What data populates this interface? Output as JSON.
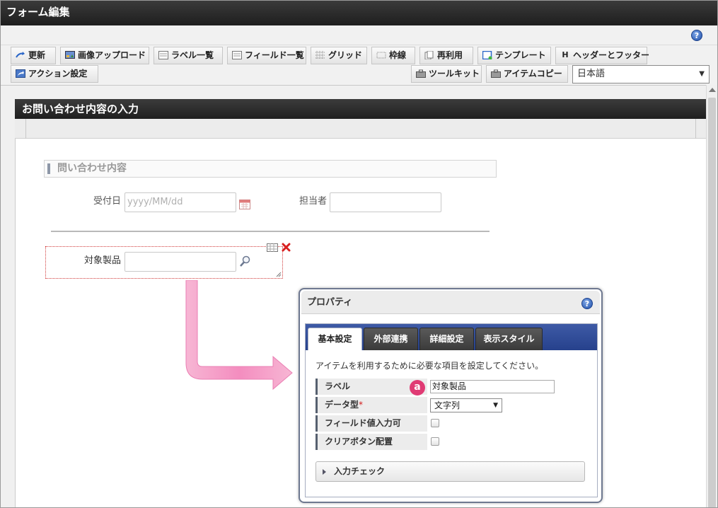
{
  "window": {
    "title": "フォーム編集"
  },
  "toolbar": {
    "row1": [
      {
        "label": "更新",
        "icon": "update-icon"
      },
      {
        "label": "画像アップロード",
        "icon": "image-upload-icon"
      },
      {
        "label": "ラベル一覧",
        "icon": "label-list-icon"
      },
      {
        "label": "フィールド一覧",
        "icon": "field-list-icon"
      },
      {
        "label": "グリッド",
        "icon": "grid-icon"
      },
      {
        "label": "枠線",
        "icon": "border-icon"
      },
      {
        "label": "再利用",
        "icon": "reuse-icon"
      },
      {
        "label": "テンプレート",
        "icon": "template-icon"
      },
      {
        "label": "ヘッダーとフッター",
        "icon": "header-footer-icon",
        "glyph": "H"
      }
    ],
    "row2": [
      {
        "label": "アクション設定",
        "icon": "action-settings-icon"
      },
      {
        "label": "ツールキット",
        "icon": "toolkit-icon"
      },
      {
        "label": "アイテムコピー",
        "icon": "item-copy-icon"
      }
    ],
    "language": "日本語"
  },
  "form": {
    "header": "お問い合わせ内容の入力",
    "section_title": "問い合わせ内容",
    "fields": {
      "receipt_date_label": "受付日",
      "receipt_date_placeholder": "yyyy/MM/dd",
      "assignee_label": "担当者",
      "product_label": "対象製品"
    }
  },
  "properties": {
    "title": "プロパティ",
    "tabs": [
      "基本設定",
      "外部連携",
      "詳細設定",
      "表示スタイル"
    ],
    "description": "アイテムを利用するために必要な項目を設定してください。",
    "rows": {
      "label": {
        "name": "ラベル",
        "value": "対象製品"
      },
      "data_type": {
        "name": "データ型",
        "required_mark": "*",
        "value": "文字列"
      },
      "field_input": {
        "name": "フィールド値入力可",
        "checked": false
      },
      "clear_button": {
        "name": "クリアボタン配置",
        "checked": false
      }
    },
    "input_check": "入力チェック",
    "annotation": "a"
  },
  "colors": {
    "dark_bar": "#1e1e1e",
    "tab_strip": "#26418c",
    "accent_badge": "#e03b74",
    "arrow_pink": "#f59fc8"
  }
}
